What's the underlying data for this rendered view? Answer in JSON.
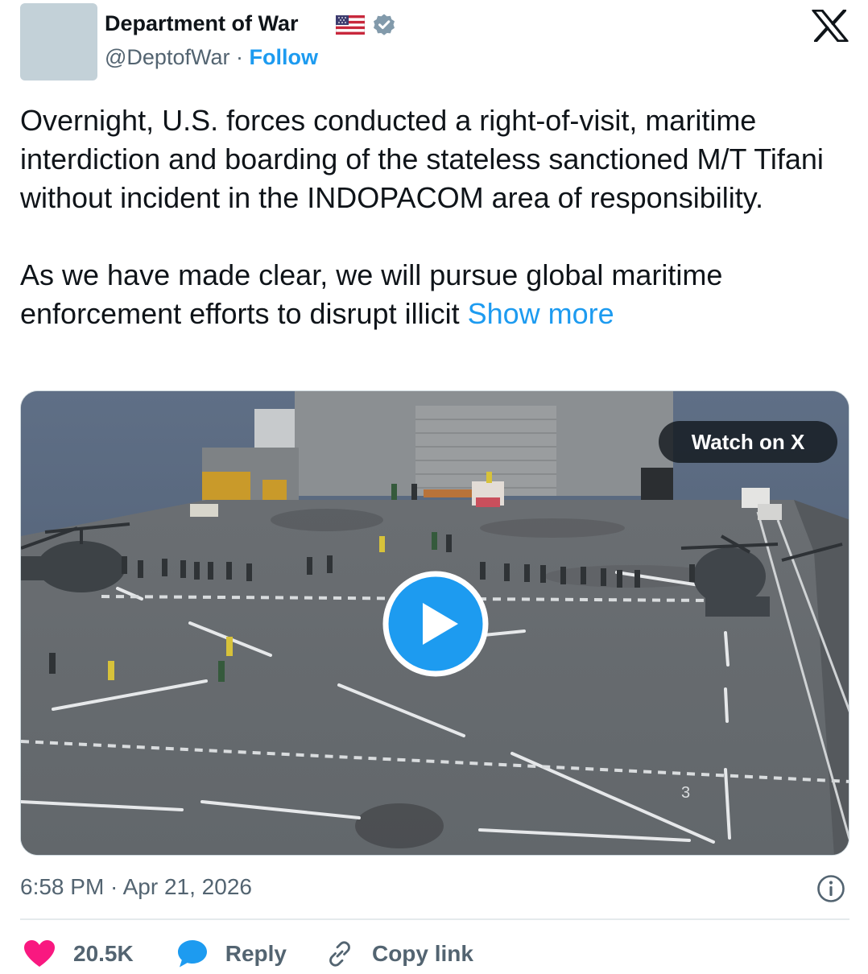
{
  "author": {
    "display_name": "Department of War",
    "handle": "@DeptofWar",
    "separator": "·",
    "follow_label": "Follow",
    "flag_icon": "us-flag-icon",
    "verified_icon": "verified-badge-icon",
    "verified_color": "#829aab"
  },
  "platform_logo": "x-logo-icon",
  "tweet": {
    "paragraph_1": "Overnight, U.S. forces conducted a right-of-visit, maritime interdiction and boarding of the stateless sanctioned M/T Tifani without incident in the INDOPACOM area of responsibility.",
    "paragraph_2": "As we have made clear, we will pursue global maritime enforcement efforts to disrupt illicit",
    "show_more_label": "Show more"
  },
  "media": {
    "watch_label": "Watch on X",
    "play_icon": "play-icon",
    "deck_number": "3"
  },
  "timestamp": "6:58 PM · Apr 21, 2026",
  "actions": {
    "likes": "20.5K",
    "reply_label": "Reply",
    "copy_link_label": "Copy link"
  },
  "colors": {
    "accent": "#1d9bf0",
    "like": "#f91880",
    "text": "#0f1419",
    "secondary": "#536471"
  }
}
